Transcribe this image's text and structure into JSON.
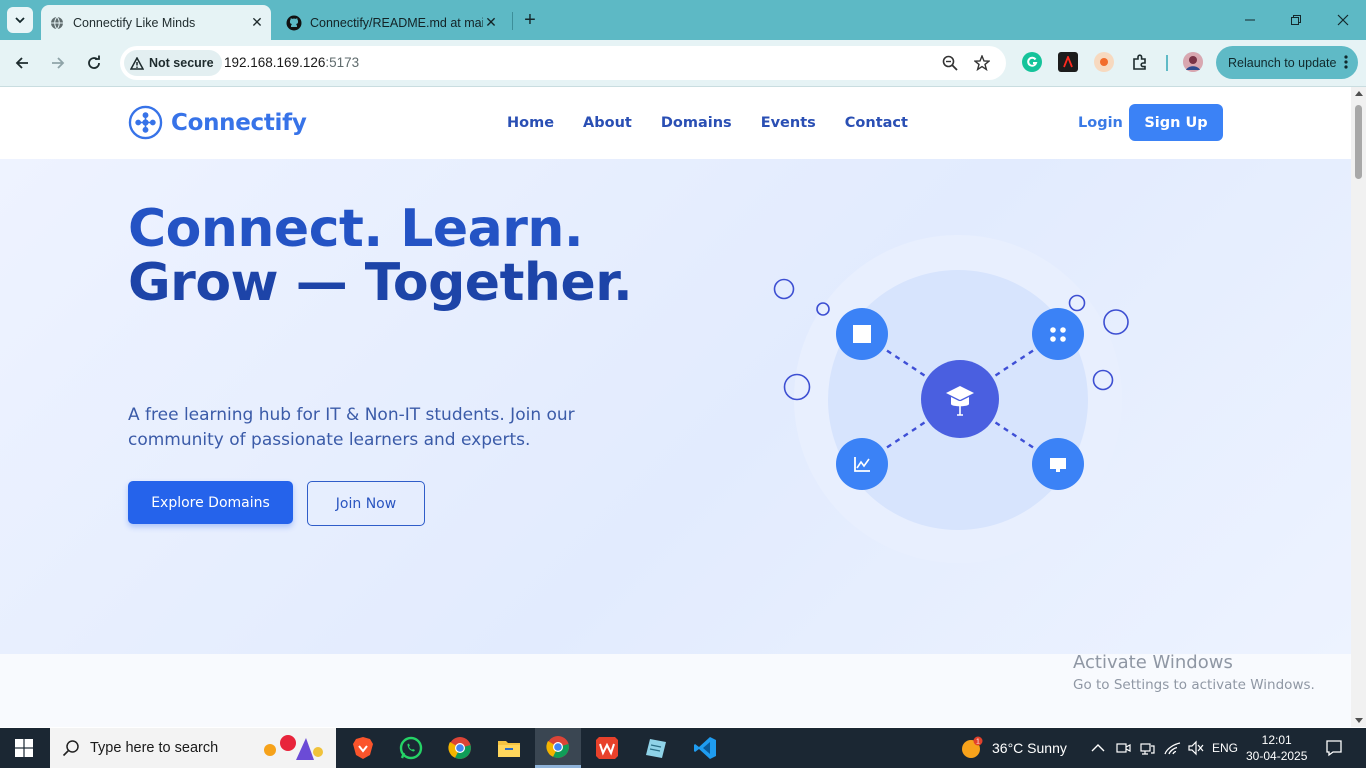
{
  "browser": {
    "tabs": [
      {
        "title": "Connectify Like Minds",
        "active": true
      },
      {
        "title": "Connectify/README.md at mai",
        "active": false
      }
    ],
    "security_label": "Not secure",
    "url_host": "192.168.169.126",
    "url_port": ":5173",
    "relaunch_label": "Relaunch to update",
    "extensions": [
      "grammarly-icon",
      "adobe-icon",
      "honey-icon",
      "puzzle-icon",
      "profile-avatar"
    ]
  },
  "site": {
    "brand": "Connectify",
    "nav": [
      "Home",
      "About",
      "Domains",
      "Events",
      "Contact"
    ],
    "login_label": "Login",
    "signup_label": "Sign Up"
  },
  "hero": {
    "headline_line1": "Connect. Learn.",
    "headline_line2": "Grow — Together.",
    "subtitle": "A free learning hub for IT & Non-IT students. Join our community of passionate learners and experts.",
    "primary_cta": "Explore Domains",
    "secondary_cta": "Join Now"
  },
  "watermark": {
    "line1": "Activate Windows",
    "line2": "Go to Settings to activate Windows."
  },
  "taskbar": {
    "search_placeholder": "Type here to search",
    "weather": "36°C  Sunny",
    "language": "ENG",
    "time": "12:01",
    "date": "30-04-2025",
    "apps": [
      "brave-icon",
      "whatsapp-icon",
      "chrome-icon",
      "file-explorer-icon",
      "chrome-active-icon",
      "wps-office-icon",
      "notepad-icon",
      "vscode-icon"
    ]
  },
  "colors": {
    "tab_strip": "#5db9c5",
    "brand_blue": "#3773e8",
    "primary_button": "#2563eb",
    "hero_text": "#2453c4"
  }
}
